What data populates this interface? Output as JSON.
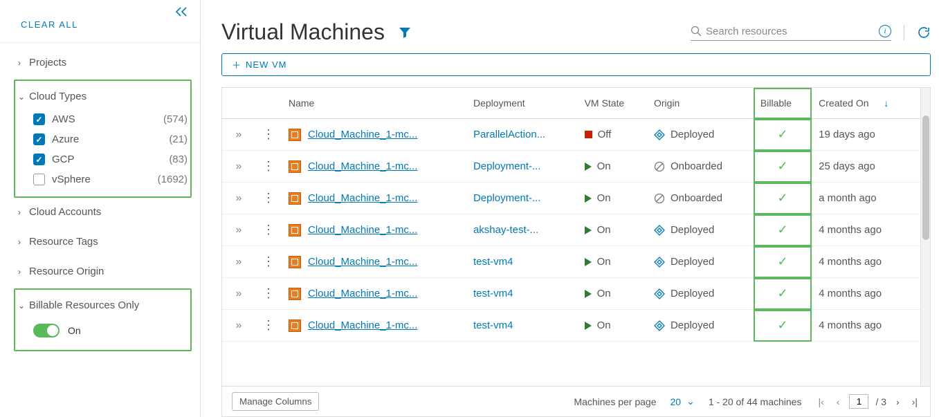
{
  "sidebar": {
    "clear_all": "CLEAR ALL",
    "groups": [
      {
        "label": "Projects",
        "expanded": false
      },
      {
        "label": "Cloud Types",
        "expanded": true,
        "highlighted": true,
        "items": [
          {
            "label": "AWS",
            "count": "(574)",
            "checked": true
          },
          {
            "label": "Azure",
            "count": "(21)",
            "checked": true
          },
          {
            "label": "GCP",
            "count": "(83)",
            "checked": true
          },
          {
            "label": "vSphere",
            "count": "(1692)",
            "checked": false
          }
        ]
      },
      {
        "label": "Cloud Accounts",
        "expanded": false
      },
      {
        "label": "Resource Tags",
        "expanded": false
      },
      {
        "label": "Resource Origin",
        "expanded": false
      },
      {
        "label": "Billable Resources Only",
        "expanded": true,
        "highlighted": true,
        "toggle": {
          "label": "On",
          "on": true
        }
      }
    ]
  },
  "header": {
    "title": "Virtual Machines",
    "search_placeholder": "Search resources",
    "new_vm": "NEW VM"
  },
  "table": {
    "columns": [
      "Name",
      "Deployment",
      "VM State",
      "Origin",
      "Billable",
      "Created On"
    ],
    "sort_col": "Created On",
    "rows": [
      {
        "name": "Cloud_Machine_1-mc...",
        "deployment": "ParallelAction...",
        "state": "Off",
        "origin": "Deployed",
        "origin_type": "deployed",
        "billable": true,
        "created": "19 days ago"
      },
      {
        "name": "Cloud_Machine_1-mc...",
        "deployment": "Deployment-...",
        "state": "On",
        "origin": "Onboarded",
        "origin_type": "onboarded",
        "billable": true,
        "created": "25 days ago"
      },
      {
        "name": "Cloud_Machine_1-mc...",
        "deployment": "Deployment-...",
        "state": "On",
        "origin": "Onboarded",
        "origin_type": "onboarded",
        "billable": true,
        "created": "a month ago"
      },
      {
        "name": "Cloud_Machine_1-mc...",
        "deployment": "akshay-test-...",
        "state": "On",
        "origin": "Deployed",
        "origin_type": "deployed",
        "billable": true,
        "created": "4 months ago"
      },
      {
        "name": "Cloud_Machine_1-mc...",
        "deployment": "test-vm4",
        "state": "On",
        "origin": "Deployed",
        "origin_type": "deployed",
        "billable": true,
        "created": "4 months ago"
      },
      {
        "name": "Cloud_Machine_1-mc...",
        "deployment": "test-vm4",
        "state": "On",
        "origin": "Deployed",
        "origin_type": "deployed",
        "billable": true,
        "created": "4 months ago"
      },
      {
        "name": "Cloud_Machine_1-mc...",
        "deployment": "test-vm4",
        "state": "On",
        "origin": "Deployed",
        "origin_type": "deployed",
        "billable": true,
        "created": "4 months ago"
      }
    ]
  },
  "footer": {
    "manage_columns": "Manage Columns",
    "per_page_label": "Machines per page",
    "per_page_value": "20",
    "range": "1 - 20 of 44 machines",
    "page": "1",
    "total_pages": "/ 3"
  }
}
